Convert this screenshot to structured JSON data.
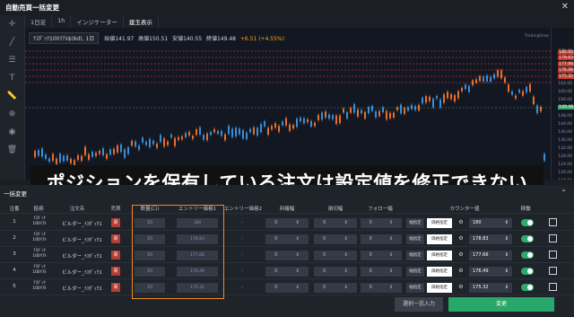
{
  "window": {
    "title": "自動売買一括変更",
    "close": "✕"
  },
  "toolbar": {
    "tools": [
      {
        "name": "crosshair-icon",
        "glyph": "✛"
      },
      {
        "name": "trendline-icon",
        "glyph": "╱"
      },
      {
        "name": "fib-icon",
        "glyph": "☰"
      },
      {
        "name": "text-icon",
        "glyph": "T"
      },
      {
        "name": "ruler-icon",
        "glyph": "📏"
      },
      {
        "name": "zoom-icon",
        "glyph": "⊕"
      },
      {
        "name": "eye-icon",
        "glyph": "◉"
      },
      {
        "name": "trash-icon",
        "glyph": "🗑"
      }
    ]
  },
  "tabs": [
    "1日足",
    "1h",
    "インジケーター",
    "建玉表示"
  ],
  "chart": {
    "symbol": "ﾅｽﾀﾞｯｸ100ﾘｱﾙ$(6d), 1日",
    "ohlc": {
      "o": "始値141.97",
      "h": "高値150.51",
      "l": "安値140.55",
      "c": "終値149.48",
      "chg": "+6.51 (+4.55%)"
    },
    "watermark": "TradingView",
    "price_ticks": [
      "178.00",
      "176.00",
      "172.00",
      "168.00",
      "164.00",
      "160.00",
      "156.00",
      "152.00",
      "148.00",
      "144.00",
      "140.00",
      "136.00",
      "132.00",
      "128.00",
      "124.00",
      "120.00",
      "116.00"
    ],
    "price_labels": [
      "180.00",
      "178.83",
      "177.66",
      "176.49",
      "175.32",
      "149.48"
    ]
  },
  "overlay": {
    "text": "ポジションを保有している注文は設定値を修正できない"
  },
  "panel": {
    "tab": "一括変更",
    "headers": [
      "注番",
      "銘柄",
      "注文名",
      "売買",
      "数量(口)",
      "エントリー価格1",
      "エントリー価格2",
      "利確幅",
      "損切幅",
      "フォロー幅",
      "カウンター値",
      "稼働"
    ],
    "rows": [
      {
        "num": "1",
        "sym": "ﾅｽﾀﾞｯｸ\n100ﾘｱﾙ",
        "name": "ビルダー_ﾅｽﾀﾞｯｸ1",
        "side": "買",
        "qty": "10",
        "entry1": "180",
        "entry2": "-",
        "tp": "0",
        "sl": "0",
        "follow": "0",
        "specify": "幅指定",
        "price": "価格指定",
        "counter": "180"
      },
      {
        "num": "2",
        "sym": "ﾅｽﾀﾞｯｸ\n100ﾘｱﾙ",
        "name": "ビルダー_ﾅｽﾀﾞｯｸ1",
        "side": "買",
        "qty": "10",
        "entry1": "178.83",
        "entry2": "-",
        "tp": "0",
        "sl": "0",
        "follow": "0",
        "specify": "幅指定",
        "price": "価格指定",
        "counter": "178.83"
      },
      {
        "num": "3",
        "sym": "ﾅｽﾀﾞｯｸ\n100ﾘｱﾙ",
        "name": "ビルダー_ﾅｽﾀﾞｯｸ1",
        "side": "買",
        "qty": "10",
        "entry1": "177.66",
        "entry2": "-",
        "tp": "0",
        "sl": "0",
        "follow": "0",
        "specify": "幅指定",
        "price": "価格指定",
        "counter": "177.66"
      },
      {
        "num": "4",
        "sym": "ﾅｽﾀﾞｯｸ\n100ﾘｱﾙ",
        "name": "ビルダー_ﾅｽﾀﾞｯｸ1",
        "side": "買",
        "qty": "10",
        "entry1": "176.49",
        "entry2": "-",
        "tp": "0",
        "sl": "0",
        "follow": "0",
        "specify": "幅指定",
        "price": "価格指定",
        "counter": "176.49"
      },
      {
        "num": "5",
        "sym": "ﾅｽﾀﾞｯｸ\n100ﾘｱﾙ",
        "name": "ビルダー_ﾅｽﾀﾞｯｸ1",
        "side": "買",
        "qty": "10",
        "entry1": "175.32",
        "entry2": "-",
        "tp": "0",
        "sl": "0",
        "follow": "0",
        "specify": "幅指定",
        "price": "価格指定",
        "counter": "175.32"
      }
    ],
    "buttons": {
      "bulk": "選択一括入力",
      "change": "変更"
    }
  },
  "colors": {
    "accent_orange": "#f08a1c",
    "green": "#29a66a",
    "sell_red": "#b43c32",
    "bg": "#1f232a"
  }
}
